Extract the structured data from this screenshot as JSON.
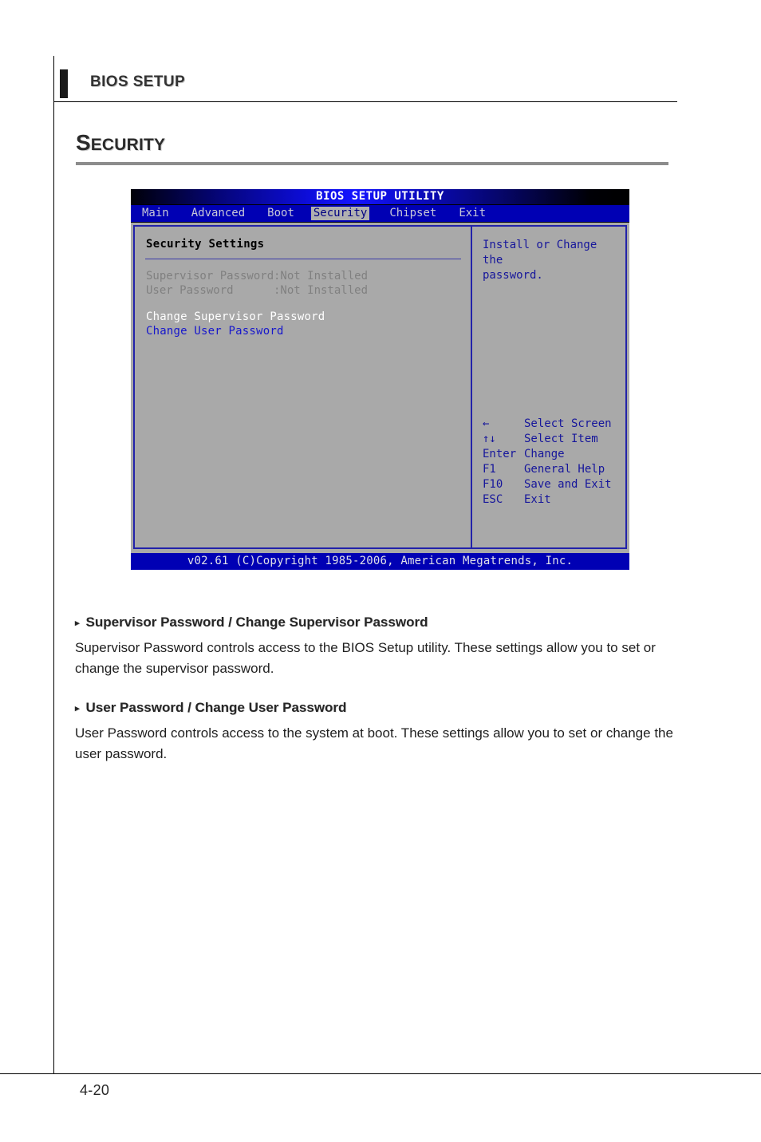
{
  "document": {
    "running_header": "BIOS SETUP",
    "section_title_cap": "S",
    "section_title_rest": "ECURITY",
    "page_number": "4-20"
  },
  "bios": {
    "title": "BIOS SETUP UTILITY",
    "menu_tabs": [
      {
        "label": "Main",
        "active": false
      },
      {
        "label": "Advanced",
        "active": false
      },
      {
        "label": "Boot",
        "active": false
      },
      {
        "label": "Security",
        "active": true
      },
      {
        "label": "Chipset",
        "active": false
      },
      {
        "label": "Exit",
        "active": false
      }
    ],
    "section_heading": "Security Settings",
    "status_rows": [
      {
        "key": "Supervisor Password",
        "value": ":Not Installed"
      },
      {
        "key": "User Password",
        "value": ":Not Installed"
      }
    ],
    "actions": [
      {
        "label": "Change Supervisor Password",
        "selected": false
      },
      {
        "label": "Change User Password",
        "selected": true
      }
    ],
    "help_text": "Install or Change the\npassword.",
    "key_legend": [
      {
        "key": "←",
        "desc": "Select Screen"
      },
      {
        "key": "↑↓",
        "desc": "Select Item"
      },
      {
        "key": "Enter",
        "desc": "Change"
      },
      {
        "key": "F1",
        "desc": "General Help"
      },
      {
        "key": "F10",
        "desc": "Save and Exit"
      },
      {
        "key": "ESC",
        "desc": "Exit"
      }
    ],
    "footer": "v02.61 (C)Copyright 1985-2006, American Megatrends, Inc.",
    "colors": {
      "panel_gray": "#a9a9a9",
      "bar_blue": "#0000b4",
      "border_blue": "#2222aa",
      "help_blue": "#16169b",
      "selected_blue": "#1616cc",
      "disabled_gray": "#808080"
    }
  },
  "prose": {
    "entries": [
      {
        "bullet": "▸",
        "heading": "Supervisor Password / Change Supervisor Password",
        "text": "Supervisor Password controls access to the BIOS Setup utility. These settings allow you to set or change the supervisor password."
      },
      {
        "bullet": "▸",
        "heading": "User Password / Change User Password",
        "text": "User Password controls access to the system at boot. These settings allow you to set or change the user password."
      }
    ]
  }
}
